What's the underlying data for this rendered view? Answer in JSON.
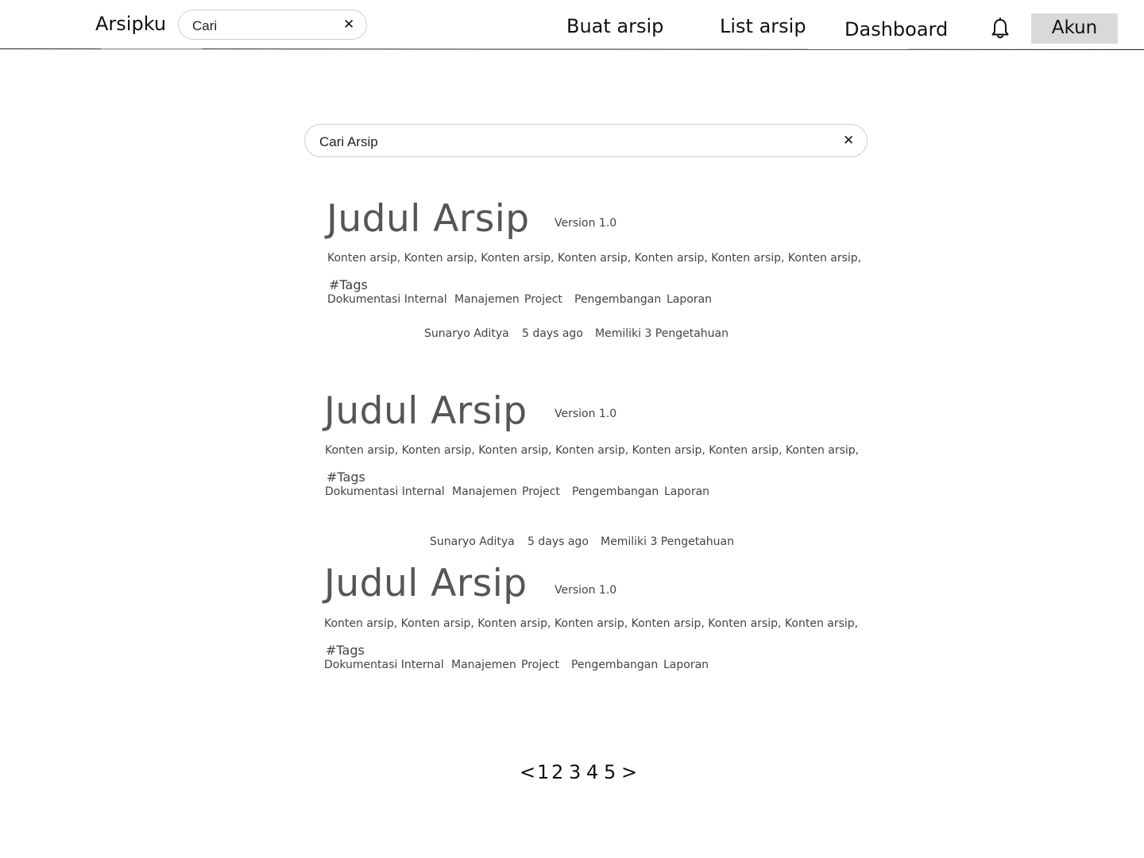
{
  "header": {
    "brand": "Arsipku",
    "search_placeholder": "Cari",
    "nav": [
      "Buat arsip",
      "List arsip",
      "Dashboard"
    ],
    "account_label": "Akun",
    "bell_icon": "bell-icon",
    "clear_icon": "✕"
  },
  "main": {
    "search_placeholder": "Cari Arsip",
    "clear_icon": "✕"
  },
  "archives": [
    {
      "title": "Judul Arsip",
      "version": "Version 1.0",
      "content": "Konten arsip, Konten arsip, Konten arsip, Konten arsip, Konten arsip, Konten arsip, Konten arsip,",
      "tags_heading": "#Tags",
      "tags": [
        "Dokumentasi Internal",
        "Manajemen",
        "Project",
        "Pengembangan",
        "Laporan"
      ],
      "author": "Sunaryo Aditya",
      "time": "5 days ago",
      "knowledge": "Memiliki 3 Pengetahuan"
    },
    {
      "title": "Judul Arsip",
      "version": "Version 1.0",
      "content": "Konten arsip, Konten arsip, Konten arsip, Konten arsip, Konten arsip, Konten arsip, Konten arsip,",
      "tags_heading": "#Tags",
      "tags": [
        "Dokumentasi Internal",
        "Manajemen",
        "Project",
        "Pengembangan",
        "Laporan"
      ],
      "author": "Sunaryo Aditya",
      "time": "5 days ago",
      "knowledge": "Memiliki 3 Pengetahuan"
    },
    {
      "title": "Judul Arsip",
      "version": "Version 1.0",
      "content": "Konten arsip, Konten arsip, Konten arsip, Konten arsip, Konten arsip, Konten arsip, Konten arsip,",
      "tags_heading": "#Tags",
      "tags": [
        "Dokumentasi Internal",
        "Manajemen",
        "Project",
        "Pengembangan",
        "Laporan"
      ]
    }
  ],
  "pagination": {
    "prev": "<",
    "pages": [
      "1",
      "2",
      "3",
      "4",
      "5"
    ],
    "next": ">"
  }
}
